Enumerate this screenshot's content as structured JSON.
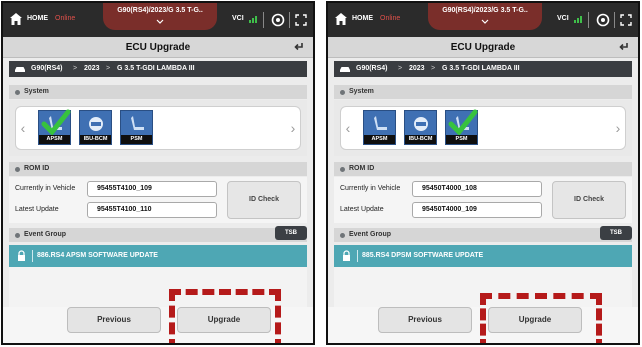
{
  "panels": [
    {
      "topbar": {
        "home_label": "HOME",
        "status": "Online",
        "vehicle_label": "G90(RS4)/2023/G 3.5 T-G..",
        "vci_label": "VCI"
      },
      "title": "ECU Upgrade",
      "breadcrumb": [
        "G90(RS4)",
        "2023",
        "G 3.5 T-GDI LAMBDA III"
      ],
      "system": {
        "header": "System",
        "items": [
          {
            "label": "APSM",
            "icon": "seat-icon",
            "selected": true
          },
          {
            "label": "IBU-BCM",
            "icon": "ibu-icon",
            "selected": false
          },
          {
            "label": "PSM",
            "icon": "seat-icon",
            "selected": false
          }
        ]
      },
      "rom": {
        "header": "ROM ID",
        "current_label": "Currently in Vehicle",
        "current_value": "95455T4100_109",
        "latest_label": "Latest Update",
        "latest_value": "95455T4100_110",
        "id_check_label": "ID Check"
      },
      "event": {
        "header": "Event Group",
        "tsb_label": "TSB",
        "item": "886.RS4 APSM SOFTWARE UPDATE"
      },
      "buttons": {
        "previous": "Previous",
        "upgrade": "Upgrade"
      }
    },
    {
      "topbar": {
        "home_label": "HOME",
        "status": "Online",
        "vehicle_label": "G90(RS4)/2023/G 3.5 T-G..",
        "vci_label": "VCI"
      },
      "title": "ECU Upgrade",
      "breadcrumb": [
        "G90(RS4)",
        "2023",
        "G 3.5 T-GDI LAMBDA III"
      ],
      "system": {
        "header": "System",
        "items": [
          {
            "label": "APSM",
            "icon": "seat-icon",
            "selected": false
          },
          {
            "label": "IBU-BCM",
            "icon": "ibu-icon",
            "selected": false
          },
          {
            "label": "PSM",
            "icon": "seat-icon",
            "selected": true
          }
        ]
      },
      "rom": {
        "header": "ROM ID",
        "current_label": "Currently in Vehicle",
        "current_value": "95450T4000_108",
        "latest_label": "Latest Update",
        "latest_value": "95450T4000_109",
        "id_check_label": "ID Check"
      },
      "event": {
        "header": "Event Group",
        "tsb_label": "TSB",
        "item": "885.RS4 DPSM SOFTWARE UPDATE"
      },
      "buttons": {
        "previous": "Previous",
        "upgrade": "Upgrade"
      }
    }
  ],
  "colors": {
    "topbar": "#2b2b2b",
    "vehicle_tab": "#7a2e2a",
    "status": "#e0504a",
    "event_bar": "#4ea7b4",
    "highlight": "#b51a1a",
    "system_tile": "#3f70b3"
  }
}
